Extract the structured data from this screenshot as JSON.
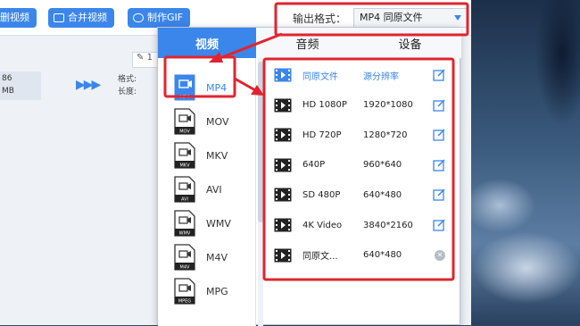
{
  "toolbar": {
    "buttons": [
      {
        "label": "删视频"
      },
      {
        "label": "合并视频"
      },
      {
        "label": "制作GIF"
      }
    ]
  },
  "output_format": {
    "label": "输出格式：",
    "value": "MP4  同原文件"
  },
  "file": {
    "thumb_lines": [
      "86",
      "MB"
    ],
    "meta_lines": [
      "格式:",
      "长度:"
    ],
    "edit_chip": "1"
  },
  "popup": {
    "tabs": [
      {
        "label": "视频"
      },
      {
        "label": "音频"
      },
      {
        "label": "设备"
      }
    ],
    "formats": [
      {
        "name": "MP4",
        "tag": "MP4"
      },
      {
        "name": "MOV",
        "tag": "MOV"
      },
      {
        "name": "MKV",
        "tag": "MKV"
      },
      {
        "name": "AVI",
        "tag": "AVI"
      },
      {
        "name": "WMV",
        "tag": "WMV"
      },
      {
        "name": "M4V",
        "tag": "M4V"
      },
      {
        "name": "MPG",
        "tag": "MPEG"
      }
    ],
    "resolutions": [
      {
        "name": "同原文件",
        "value": "源分辨率"
      },
      {
        "name": "HD 1080P",
        "value": "1920*1080"
      },
      {
        "name": "HD 720P",
        "value": "1280*720"
      },
      {
        "name": "640P",
        "value": "960*640"
      },
      {
        "name": "SD 480P",
        "value": "640*480"
      },
      {
        "name": "4K Video",
        "value": "3840*2160"
      },
      {
        "name": "同原文...",
        "value": "640*480"
      }
    ]
  },
  "colors": {
    "accent": "#3b86ea",
    "highlight_red": "#e0242f"
  }
}
